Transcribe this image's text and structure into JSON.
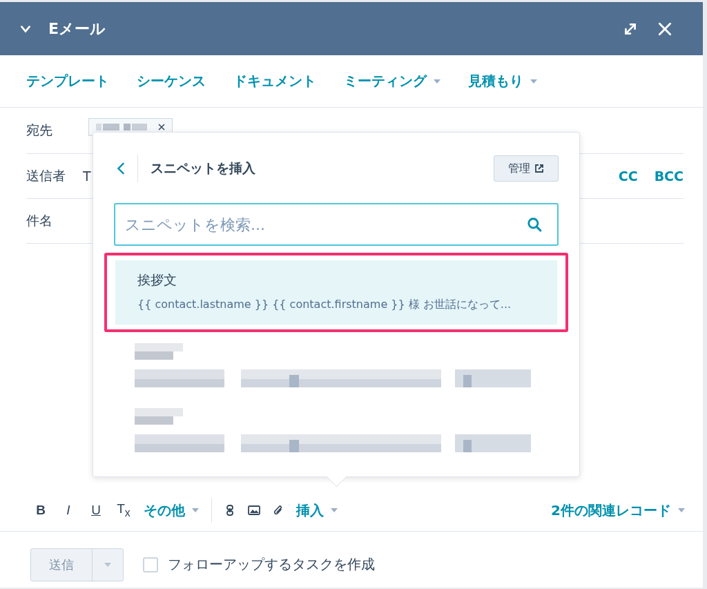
{
  "window": {
    "title": "Eメール"
  },
  "tabs": [
    {
      "label": "テンプレート",
      "has_menu": false
    },
    {
      "label": "シーケンス",
      "has_menu": false
    },
    {
      "label": "ドキュメント",
      "has_menu": false
    },
    {
      "label": "ミーティング",
      "has_menu": true
    },
    {
      "label": "見積もり",
      "has_menu": true
    }
  ],
  "fields": [
    {
      "label": "宛先",
      "kind": "recipient"
    },
    {
      "label": "送信者",
      "kind": "sender",
      "value": "T"
    },
    {
      "label": "件名",
      "kind": "subject"
    }
  ],
  "cc_links": [
    "CC",
    "BCC"
  ],
  "snippet_popup": {
    "title": "スニペットを挿入",
    "manage_button": "管理",
    "search": {
      "placeholder": "スニペットを検索..."
    },
    "items": [
      {
        "kind": "snippet",
        "name": "挨拶文",
        "preview": "{{ contact.lastname }} {{ contact.firstname }} 様 お世話になって...",
        "selected": true,
        "outlined": true
      },
      {
        "kind": "redacted"
      },
      {
        "kind": "redacted"
      }
    ]
  },
  "toolbar": {
    "format_buttons": [
      {
        "kind": "bold",
        "label": "B"
      },
      {
        "kind": "italic",
        "label": "I"
      },
      {
        "kind": "underline",
        "label": "U"
      },
      {
        "kind": "clear",
        "label": "T$_{x}$"
      }
    ],
    "more_menu": "その他",
    "insert_menu": "挿入",
    "records_menu": "2件の関連レコード"
  },
  "footer": {
    "send_button": "送信",
    "send_disabled": true,
    "followup_task": {
      "label": "フォローアップするタスクを作成",
      "checked": false
    }
  }
}
